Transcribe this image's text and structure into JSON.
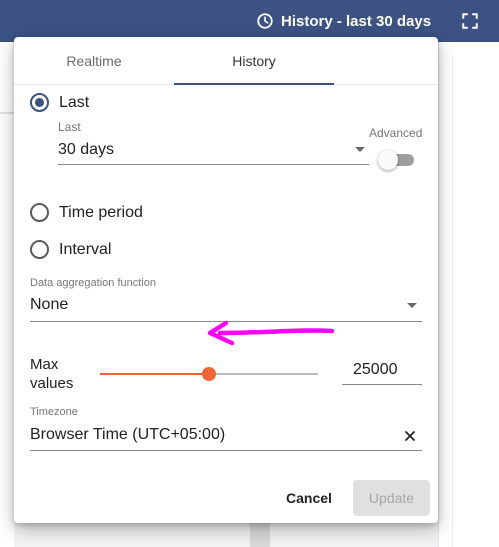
{
  "header": {
    "title": "History - last 30 days"
  },
  "tabs": [
    {
      "label": "Realtime",
      "selected": false
    },
    {
      "label": "History",
      "selected": true
    }
  ],
  "options": {
    "last": {
      "label": "Last",
      "checked": true
    },
    "time_period": {
      "label": "Time period",
      "checked": false
    },
    "interval": {
      "label": "Interval",
      "checked": false
    }
  },
  "last_field": {
    "label": "Last",
    "value": "30 days"
  },
  "advanced": {
    "label": "Advanced",
    "enabled": false
  },
  "aggregation": {
    "label": "Data aggregation function",
    "value": "None"
  },
  "max_values": {
    "label": "Max values",
    "value": "25000",
    "slider_fraction": 0.5
  },
  "timezone": {
    "label": "Timezone",
    "value": "Browser Time (UTC+05:00)"
  },
  "actions": {
    "cancel": "Cancel",
    "update": "Update"
  },
  "colors": {
    "header": "#3b5283",
    "accent": "#3b5283",
    "slider": "#f26532",
    "annotation_arrow": "#ff00ff"
  }
}
